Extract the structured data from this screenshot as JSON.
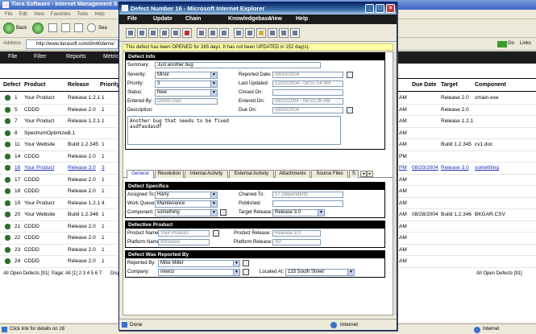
{
  "bg_window": {
    "title": "Tiera Software - Internet Management S",
    "menu": [
      "File",
      "Edit",
      "View",
      "Favorites",
      "Tools",
      "Help"
    ],
    "back_label": "Back",
    "search_label": "Sea",
    "address_label": "Address",
    "address_value": "http://www.tierasoft.com/dm40demo/",
    "go_label": "Go",
    "links_label": "Links",
    "nav": [
      "File",
      "Filter",
      "Reports",
      "Metric"
    ],
    "columns": {
      "defect": "Defect",
      "product": "Product",
      "release": "Release",
      "priority": "Priority",
      "due_date": "Due Date",
      "target": "Target",
      "component": "Component"
    },
    "rows": [
      {
        "id": "1",
        "product": "Your Product",
        "release": "Release 1.2.1",
        "priority": "1",
        "time": "AM",
        "due": "",
        "target": "Release 2.0",
        "component": "cmain.exe"
      },
      {
        "id": "5",
        "product": "CDDD",
        "release": "Release 2.0",
        "priority": "1",
        "time": "AM",
        "due": "",
        "target": "Release 2.0",
        "component": ""
      },
      {
        "id": "7",
        "product": "Your Product",
        "release": "Release 1.2.1",
        "priority": "1",
        "time": "AM",
        "due": "",
        "target": "Release 1.2.1",
        "component": ""
      },
      {
        "id": "8",
        "product": "SpectrumOptimizer",
        "release": "3.1",
        "priority": "",
        "time": "AM",
        "due": "",
        "target": "",
        "component": ""
      },
      {
        "id": "11",
        "product": "Your Website",
        "release": "Build 1.2.345",
        "priority": "1",
        "time": "AM",
        "due": "",
        "target": "Build 1.2.345",
        "component": "cv1.doc"
      },
      {
        "id": "14",
        "product": "CDDD",
        "release": "Release 2.0",
        "priority": "1",
        "time": "PM",
        "due": "",
        "target": "",
        "component": ""
      },
      {
        "id": "16",
        "product": "Your Product",
        "release": "Release 3.0",
        "priority": "3",
        "time": "PM",
        "due": "08/20/2004",
        "target": "Release 3.0",
        "component": "something"
      },
      {
        "id": "17",
        "product": "CDDD",
        "release": "Release 2.0",
        "priority": "1",
        "time": "AM",
        "due": "",
        "target": "",
        "component": ""
      },
      {
        "id": "18",
        "product": "CDDD",
        "release": "Release 2.0",
        "priority": "1",
        "time": "AM",
        "due": "",
        "target": "",
        "component": ""
      },
      {
        "id": "19",
        "product": "Your Product",
        "release": "Release 1.2.1",
        "priority": "4",
        "time": "AM",
        "due": "",
        "target": "",
        "component": ""
      },
      {
        "id": "20",
        "product": "Your Website",
        "release": "Build 1.2.346",
        "priority": "1",
        "time": "AM",
        "due": "08/28/2004",
        "target": "Build 1.2.346",
        "component": "BKGAR.CSV"
      },
      {
        "id": "21",
        "product": "CDDD",
        "release": "Release 2.0",
        "priority": "1",
        "time": "AM",
        "due": "",
        "target": "",
        "component": ""
      },
      {
        "id": "22",
        "product": "CDDD",
        "release": "Release 2.0",
        "priority": "1",
        "time": "AM",
        "due": "",
        "target": "",
        "component": ""
      },
      {
        "id": "23",
        "product": "CDDD",
        "release": "Release 2.0",
        "priority": "1",
        "time": "AM",
        "due": "",
        "target": "",
        "component": ""
      },
      {
        "id": "24",
        "product": "CDDD",
        "release": "Release 2.0",
        "priority": "1",
        "time": "AM",
        "due": "",
        "target": "",
        "component": ""
      }
    ],
    "footer_left": "All Open Defects [91]",
    "pages": "Page: All [1] 2 3 4 5 6 7",
    "footer_disp": "Disp",
    "footer_right": "All Open Defects [91]",
    "status_text": "Click link for details on 16",
    "status_zone": "Internet"
  },
  "dialog": {
    "title": "Defect Number 16 - Microsoft Internet Explorer",
    "menu": [
      "File",
      "Update",
      "Chain",
      "Knowledgebase",
      "View",
      "Help"
    ],
    "notice": "This defect has been OPENED for 265 days.  It has not been UPDATED in 152 day(s).",
    "info": {
      "header": "Defect Info",
      "summary_label": "Summary:",
      "summary": "Just another bug",
      "severity_label": "Severity:",
      "severity": "Minor",
      "priority_label": "Priority:",
      "priority": "3",
      "status_label": "Status:",
      "status": "New",
      "entered_by_label": "Entered By:",
      "entered_by": "Demo User",
      "description_label": "Description:",
      "reported_date_label": "Reported Date:",
      "reported_date": "08/10/2004",
      "last_updated_label": "Last Updated:",
      "last_updated": "12/02/2004 - 08:07:14 AM",
      "closed_on_label": "Closed On:",
      "closed_on": "",
      "entered_on_label": "Entered On:",
      "entered_on": "08/11/2004 - 08:50:26 AM",
      "due_on_label": "Due On:",
      "due_on": "08/20/2004",
      "description": "Another bug that needs to be fixed\nasdfasdasdf"
    },
    "tabs": [
      "General",
      "Resolution",
      "Internal Activity",
      "External Activity",
      "Attachments",
      "Source Files",
      "S"
    ],
    "specifics": {
      "header": "Defect Specifics",
      "assigned_to_label": "Assigned To:",
      "assigned_to": "Harry",
      "work_queue_label": "Work Queue:",
      "work_queue": "Maintenance",
      "component_label": "Component:",
      "component": "something",
      "chained_to_label": "Chained To:",
      "chained_to": "17 (dependent)",
      "published_label": "Published:",
      "published": "",
      "target_release_label": "Target Release:",
      "target_release": "Release 3.0"
    },
    "product": {
      "header": "Defective Product",
      "product_name_label": "Product Name:",
      "product_name": "Your Product",
      "platform_name_label": "Platform Name:",
      "platform_name": "Windows",
      "product_release_label": "Product Release:",
      "product_release": "Release 3.0",
      "platform_release_label": "Platform Release:",
      "platform_release": "XP"
    },
    "reported": {
      "header": "Defect Was Reported By",
      "reported_by_label": "Reported By:",
      "reported_by": "Mike Miller",
      "company_label": "Company:",
      "company": "newco",
      "located_at_label": "Located At:",
      "located_at": "133 South Street"
    },
    "status_text": "Done",
    "status_zone": "Internet"
  }
}
